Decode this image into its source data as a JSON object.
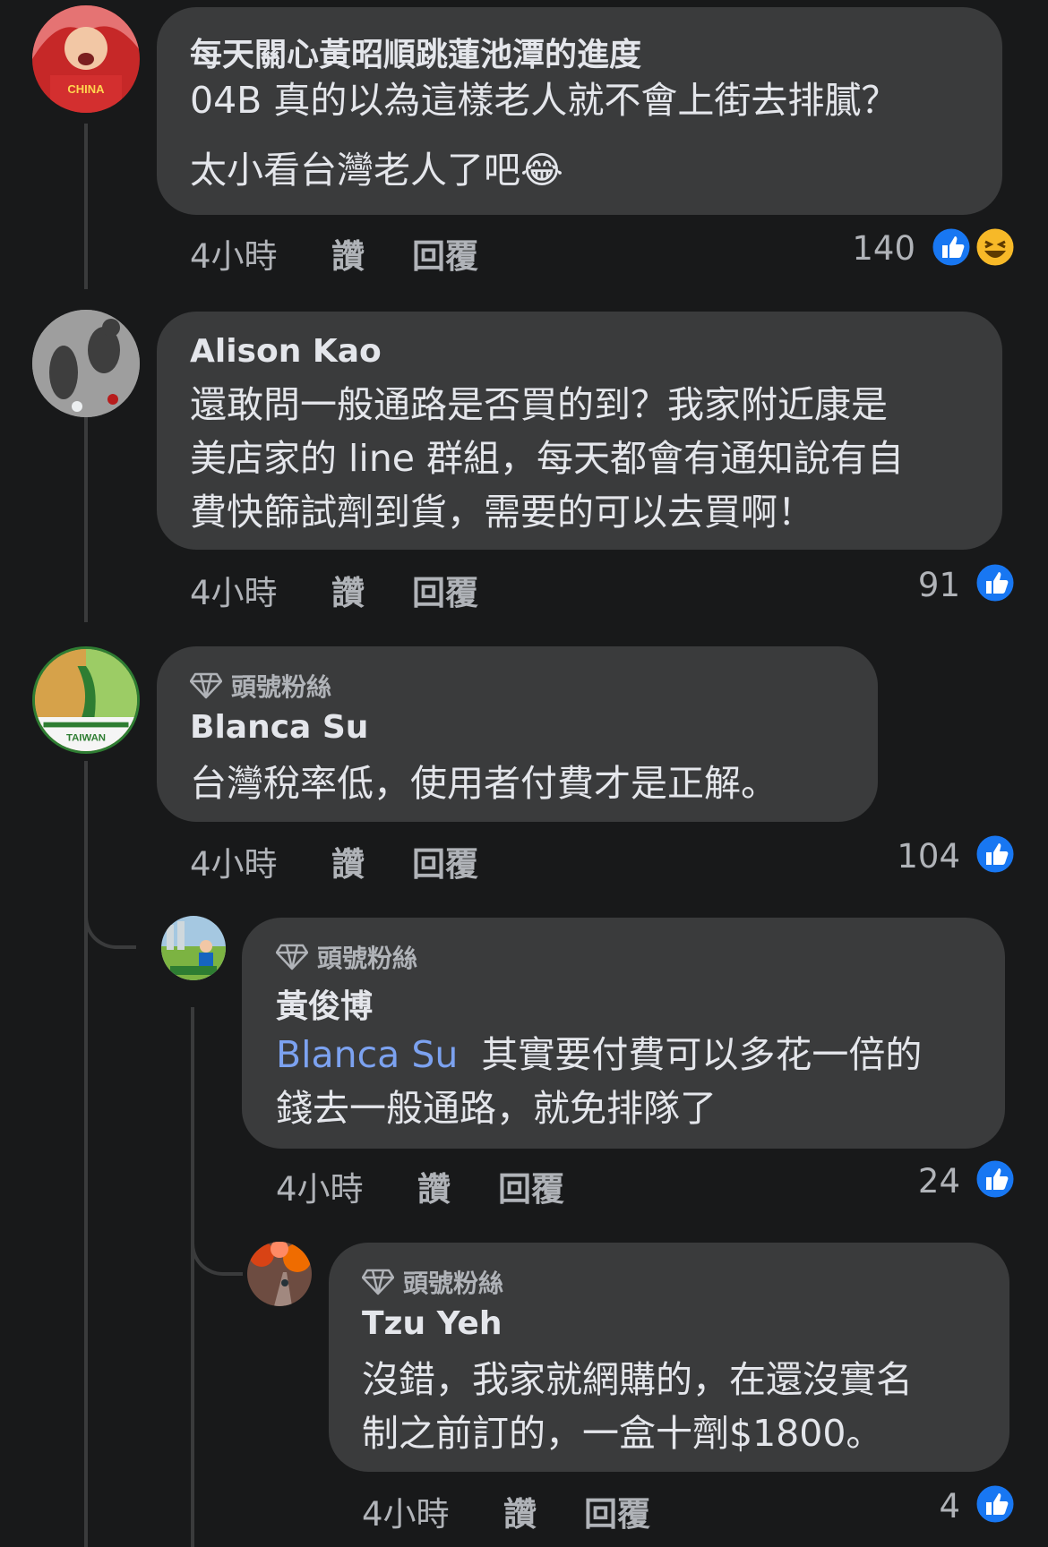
{
  "comments": [
    {
      "author": "每天關心黃昭順跳蓮池潭的進度",
      "badge": "",
      "lines": [
        "04B 真的以為這樣老人就不會上街去排膩？",
        "太小看台灣老人了吧"
      ],
      "emoji_inline": "😂",
      "time": "4小時",
      "like": "讚",
      "reply": "回覆",
      "reaction_count": "140",
      "reactions": [
        "like-icon",
        "haha-icon"
      ]
    },
    {
      "author": "Alison Kao",
      "badge": "",
      "lines": [
        "還敢問一般通路是否買的到？我家附近康是",
        "美店家的 line 群組，每天都會有通知說有自",
        "費快篩試劑到貨，需要的可以去買啊！"
      ],
      "time": "4小時",
      "like": "讚",
      "reply": "回覆",
      "reaction_count": "91",
      "reactions": [
        "like-icon"
      ]
    },
    {
      "author": "Blanca Su",
      "badge": "頭號粉絲",
      "lines": [
        "台灣稅率低，使用者付費才是正解。"
      ],
      "time": "4小時",
      "like": "讚",
      "reply": "回覆",
      "reaction_count": "104",
      "reactions": [
        "like-icon"
      ]
    },
    {
      "author": "黃俊博",
      "badge": "頭號粉絲",
      "mention": "Blanca Su",
      "lines": [
        "其實要付費可以多花一倍的",
        "錢去一般通路，就免排隊了"
      ],
      "time": "4小時",
      "like": "讚",
      "reply": "回覆",
      "reaction_count": "24",
      "reactions": [
        "like-icon"
      ]
    },
    {
      "author": "Tzu Yeh",
      "badge": "頭號粉絲",
      "lines": [
        "沒錯，我家就網購的，在還沒實名",
        "制之前訂的，一盒十劑$1800。"
      ],
      "time": "4小時",
      "like": "讚",
      "reply": "回覆",
      "reaction_count": "4",
      "reactions": [
        "like-icon"
      ]
    }
  ],
  "colors": {
    "background": "#18191a",
    "bubble": "#3a3b3c",
    "text": "#e4e6eb",
    "secondary": "#b0b3b8",
    "mention": "#7ca2f0",
    "like_blue": "#1877f2",
    "haha_yellow": "#f7b928"
  }
}
